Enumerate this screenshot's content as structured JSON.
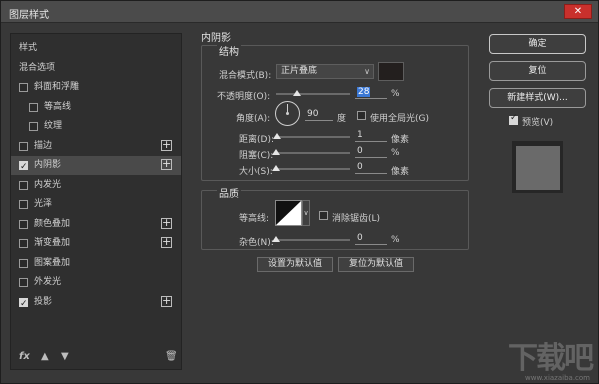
{
  "window": {
    "title": "图层样式",
    "close_label": "✕"
  },
  "sidebar": {
    "items": [
      {
        "label": "样式",
        "checkbox": false,
        "checked": false,
        "plus": false
      },
      {
        "label": "混合选项",
        "checkbox": false,
        "checked": false,
        "plus": false
      },
      {
        "label": "斜面和浮雕",
        "checkbox": true,
        "checked": false,
        "plus": false
      },
      {
        "label": "等高线",
        "checkbox": true,
        "checked": false,
        "plus": false
      },
      {
        "label": "纹理",
        "checkbox": true,
        "checked": false,
        "plus": false
      },
      {
        "label": "描边",
        "checkbox": true,
        "checked": false,
        "plus": true
      },
      {
        "label": "内阴影",
        "checkbox": true,
        "checked": true,
        "plus": true
      },
      {
        "label": "内发光",
        "checkbox": true,
        "checked": false,
        "plus": false
      },
      {
        "label": "光泽",
        "checkbox": true,
        "checked": false,
        "plus": false
      },
      {
        "label": "颜色叠加",
        "checkbox": true,
        "checked": false,
        "plus": true
      },
      {
        "label": "渐变叠加",
        "checkbox": true,
        "checked": false,
        "plus": true
      },
      {
        "label": "图案叠加",
        "checkbox": true,
        "checked": false,
        "plus": false
      },
      {
        "label": "外发光",
        "checkbox": true,
        "checked": false,
        "plus": false
      },
      {
        "label": "投影",
        "checkbox": true,
        "checked": true,
        "plus": true
      }
    ],
    "bottom": {
      "fx_label": "fx",
      "up_icon": "▲",
      "down_icon": "▼",
      "trash_icon": "🗑"
    }
  },
  "inner_shadow": {
    "section_title": "内阴影",
    "structure_title": "结构",
    "blend_mode_label": "混合模式(B):",
    "blend_mode_value": "正片叠底",
    "shadow_color": "#231f1e",
    "opacity_label": "不透明度(O):",
    "opacity_value": "28",
    "opacity_unit": "%",
    "opacity_level": 0.28,
    "angle_label": "角度(A):",
    "angle_value": "90",
    "angle_unit": "度",
    "global_light_label": "使用全局光(G)",
    "distance_label": "距离(D):",
    "distance_value": "1",
    "distance_unit": "像素",
    "distance_level": 0.01,
    "choke_label": "阻塞(C):",
    "choke_value": "0",
    "choke_unit": "%",
    "choke_level": 0,
    "size_label": "大小(S):",
    "size_value": "0",
    "size_unit": "像素",
    "size_level": 0,
    "quality_title": "品质",
    "contour_label": "等高线:",
    "antialias_label": "消除锯齿(L)",
    "noise_label": "杂色(N):",
    "noise_value": "0",
    "noise_unit": "%",
    "noise_level": 0,
    "set_default_label": "设置为默认值",
    "reset_default_label": "复位为默认值"
  },
  "actions": {
    "ok_label": "确定",
    "reset_label": "复位",
    "new_style_label": "新建样式(W)...",
    "preview_label": "预览(V)",
    "preview_checked": true
  },
  "watermark": {
    "text": "下载吧",
    "url": "www.xiazaiba.com"
  }
}
